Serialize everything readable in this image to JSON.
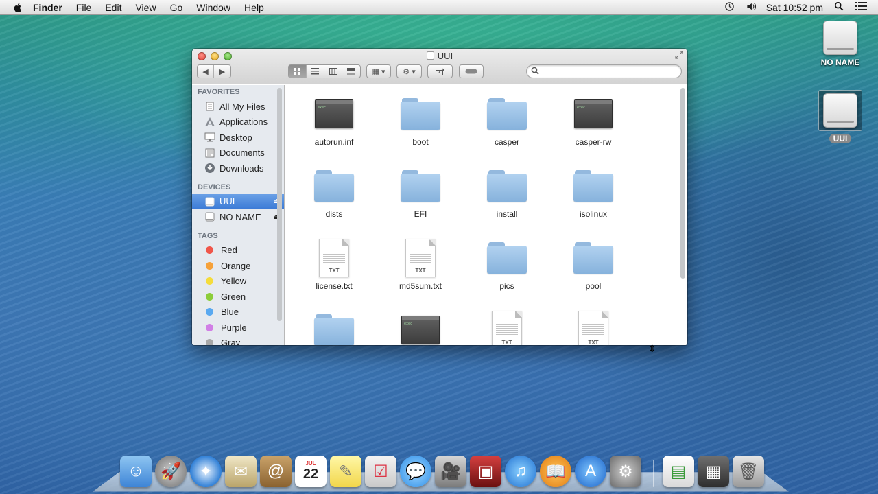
{
  "menubar": {
    "app": "Finder",
    "items": [
      "File",
      "Edit",
      "View",
      "Go",
      "Window",
      "Help"
    ],
    "clock": "Sat 10:52 pm"
  },
  "desktop": {
    "drives": [
      {
        "label": "NO NAME"
      },
      {
        "label": "UUI"
      }
    ]
  },
  "window": {
    "title": "UUI",
    "search_placeholder": ""
  },
  "sidebar": {
    "favorites_header": "FAVORITES",
    "favorites": [
      "All My Files",
      "Applications",
      "Desktop",
      "Documents",
      "Downloads"
    ],
    "devices_header": "DEVICES",
    "devices": [
      "UUI",
      "NO NAME"
    ],
    "tags_header": "TAGS",
    "tags": [
      {
        "label": "Red",
        "color": "#f0564a"
      },
      {
        "label": "Orange",
        "color": "#f6a139"
      },
      {
        "label": "Yellow",
        "color": "#f5dc3b"
      },
      {
        "label": "Green",
        "color": "#8ccd3a"
      },
      {
        "label": "Blue",
        "color": "#5aa9f0"
      },
      {
        "label": "Purple",
        "color": "#d17fe6"
      },
      {
        "label": "Gray",
        "color": "#a8a8a8"
      }
    ]
  },
  "files": [
    {
      "name": "autorun.inf",
      "kind": "exec"
    },
    {
      "name": "boot",
      "kind": "folder"
    },
    {
      "name": "casper",
      "kind": "folder"
    },
    {
      "name": "casper-rw",
      "kind": "exec"
    },
    {
      "name": "dists",
      "kind": "folder"
    },
    {
      "name": "EFI",
      "kind": "folder"
    },
    {
      "name": "install",
      "kind": "folder"
    },
    {
      "name": "isolinux",
      "kind": "folder"
    },
    {
      "name": "license.txt",
      "kind": "txt"
    },
    {
      "name": "md5sum.txt",
      "kind": "txt"
    },
    {
      "name": "pics",
      "kind": "folder"
    },
    {
      "name": "pool",
      "kind": "folder"
    },
    {
      "name": "",
      "kind": "folder"
    },
    {
      "name": "",
      "kind": "exec"
    },
    {
      "name": "",
      "kind": "txt"
    },
    {
      "name": "",
      "kind": "txt"
    }
  ],
  "doc_ext": "TXT",
  "dock": {
    "calendar_month": "JUL",
    "calendar_day": "22"
  }
}
